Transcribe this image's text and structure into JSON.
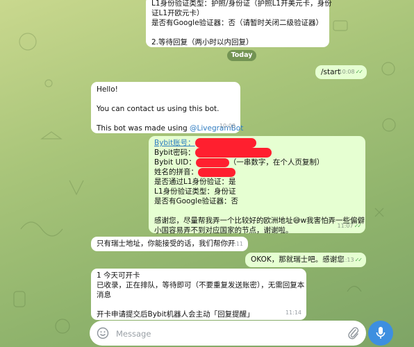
{
  "messages": {
    "top_partial": {
      "lines": [
        "L1身份验证类型：护照/身份证（护照L1开美元卡，身份",
        "证L1开欧元卡）",
        "是否有Google验证器：否（请暂时关闭二级验证器）",
        "",
        "2.等待回复（两小时以内回复）"
      ]
    },
    "date_divider": "Today",
    "start_cmd": {
      "text": "/start",
      "time": "10:08"
    },
    "bot_hello": {
      "line1": "Hello!",
      "line2": "You can contact us using this bot.",
      "line3_prefix": "This bot was made using ",
      "line3_link": "@LivegramBot",
      "time": "10:08"
    },
    "user_form": {
      "account_label": "Bybit账号：",
      "password_label": "Bybit密码：",
      "uid_label": "Bybit UID：",
      "uid_note": "（一串数字，在个人页复制）",
      "name_label": "姓名的拼音：",
      "l1_passed": "是否通过L1身份验证：是",
      "l1_type": "L1身份验证类型：身份证",
      "google": "是否有Google验证器：否",
      "thanks_a": "感谢您，尽量帮我弄一个比较好的欧洲地址",
      "thanks_emoji": "😅",
      "thanks_b": "w我害怕弄一些偏僻",
      "thanks_c": "小国容易弄不到对应国家的节点，谢谢啦。",
      "time": "11:07"
    },
    "reply_swiss": {
      "text": "只有瑞士地址，你能接受的话，我们帮你开",
      "time": "11:11"
    },
    "user_ok": {
      "text": "OKOK，那就瑞士吧。感谢您",
      "time": "11:13"
    },
    "reply_queue": {
      "lines": [
        "1 今天可开卡",
        "已收录，正在排队，等待即可（不要重复发送账密），无需回复本",
        "消息",
        "",
        "开卡申请提交后Bybit机器人会主动「回复提醒」"
      ],
      "time": "11:14"
    }
  },
  "composer": {
    "placeholder": "Message",
    "emoji_icon": "emoji-icon",
    "attach_icon": "paperclip-icon",
    "mic_icon": "microphone-icon"
  },
  "colors": {
    "incoming": "#ffffff",
    "outgoing": "#e6ffd2",
    "link": "#2f7cc1",
    "read_ticks": "#4fae4e",
    "mic_button": "#3d8fe0",
    "redaction": "#ff1f2f"
  }
}
